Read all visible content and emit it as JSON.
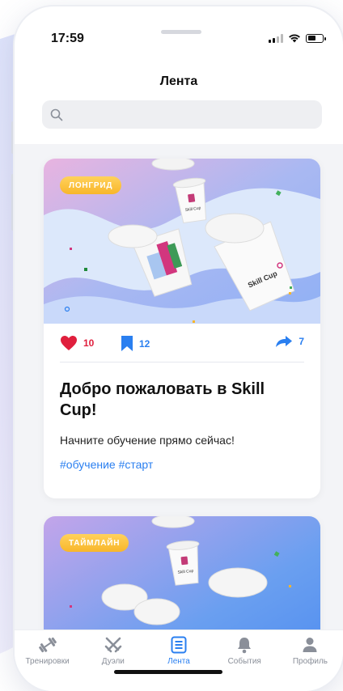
{
  "status_bar": {
    "time": "17:59"
  },
  "header": {
    "title": "Лента",
    "search_placeholder": ""
  },
  "feed": {
    "cards": [
      {
        "badge": "ЛОНГРИД",
        "likes": "10",
        "saves": "12",
        "shares": "7",
        "title": "Добро пожаловать в Skill Cup!",
        "text": "Начните обучение прямо сейчас!",
        "tags": "#обучение #старт",
        "cup_logo": "Skill Cup"
      },
      {
        "badge": "ТАЙМЛАЙН",
        "cup_logo": "Skill Cup"
      }
    ]
  },
  "tabbar": {
    "items": [
      {
        "label": "Тренировки",
        "icon": "dumbbell-icon",
        "active": false
      },
      {
        "label": "Дуэли",
        "icon": "crossed-swords-icon",
        "active": false
      },
      {
        "label": "Лента",
        "icon": "feed-icon",
        "active": true
      },
      {
        "label": "События",
        "icon": "bell-icon",
        "active": false
      },
      {
        "label": "Профиль",
        "icon": "person-icon",
        "active": false
      }
    ]
  },
  "colors": {
    "accent": "#2a7ff0",
    "like": "#e01f3d",
    "badge": "#f8b62a"
  }
}
